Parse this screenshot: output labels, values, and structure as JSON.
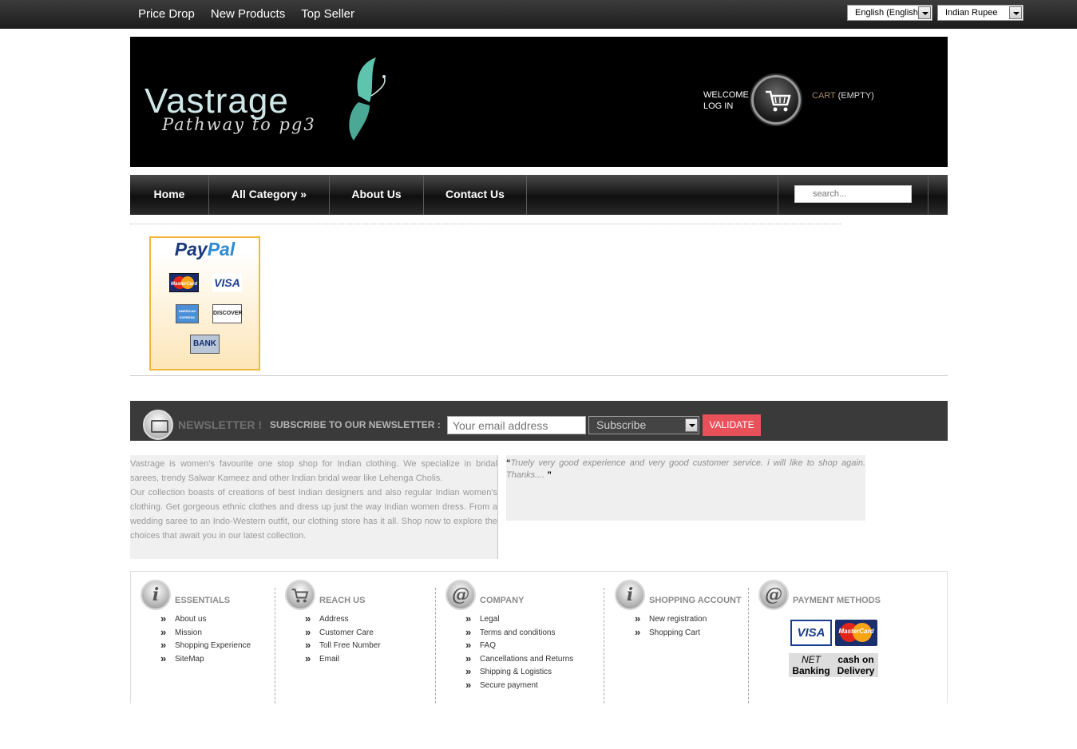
{
  "topbar": {
    "links": [
      "Price Drop",
      "New Products",
      "Top Seller"
    ],
    "language": "English (English)",
    "currency": "Indian Rupee"
  },
  "header": {
    "logo_name": "Vastrage",
    "logo_tagline": "Pathway to pg3",
    "welcome": "WELCOME",
    "login": "LOG IN",
    "cart_label": "CART",
    "cart_status": "(EMPTY)"
  },
  "nav": {
    "items": [
      "Home",
      "All Category »",
      "About Us",
      "Contact Us"
    ],
    "search_placeholder": "search..."
  },
  "paypal": {
    "title_a": "Pay",
    "title_b": "Pal",
    "cards": [
      "MasterCard",
      "VISA",
      "AMERICAN EXPRESS",
      "DISCOVER",
      "BANK"
    ]
  },
  "newsletter": {
    "title": "NEWSLETTER !",
    "subtitle": "SUBSCRIBE TO OUR NEWSLETTER :",
    "email_placeholder": "Your email address",
    "action": "Subscribe",
    "button": "VALIDATE"
  },
  "about_text": {
    "p1": "Vastrage is women's favourite one stop shop for Indian clothing. We specialize in bridal sarees, trendy Salwar Kameez and other Indian bridal wear like Lehenga Cholis.",
    "p2": "Our collection boasts of creations of best Indian designers and also regular Indian women's clothing. Get gorgeous ethnic clothes and dress up just the way Indian women dress. From a wedding saree to an Indo-Western outfit, our clothing store has it all. Shop now to explore the choices that await you in our latest collection."
  },
  "testimonial": {
    "open_quote": "“",
    "text": "Truely very good experience and very good customer service. i will like to shop again. Thanks....",
    "close_quote": "”"
  },
  "footer": {
    "columns": [
      {
        "icon": "info-icon",
        "glyph": "i",
        "title": "ESSENTIALS",
        "links": [
          "About us",
          "Mission",
          "Shopping Experience",
          "SiteMap"
        ]
      },
      {
        "icon": "cart-icon",
        "glyph": "",
        "title": "REACH US",
        "links": [
          "Address",
          "Customer Care",
          "Toll Free Number",
          "Email"
        ]
      },
      {
        "icon": "at-icon",
        "glyph": "@",
        "title": "COMPANY",
        "links": [
          "Legal",
          "Terms and conditions",
          "FAQ",
          "Cancellations and Returns",
          "Shipping & Logistics",
          "Secure payment"
        ]
      },
      {
        "icon": "info-icon",
        "glyph": "i",
        "title": "SHOPPING ACCOUNT",
        "links": [
          "New registration",
          "Shopping Cart"
        ]
      }
    ],
    "payment": {
      "glyph": "@",
      "title": "PAYMENT METHODS",
      "visa": "VISA",
      "mastercard": "MasterCard",
      "net_a": "NET",
      "net_b": "Banking",
      "cod_a": "cash on",
      "cod_b": "Delivery"
    }
  }
}
